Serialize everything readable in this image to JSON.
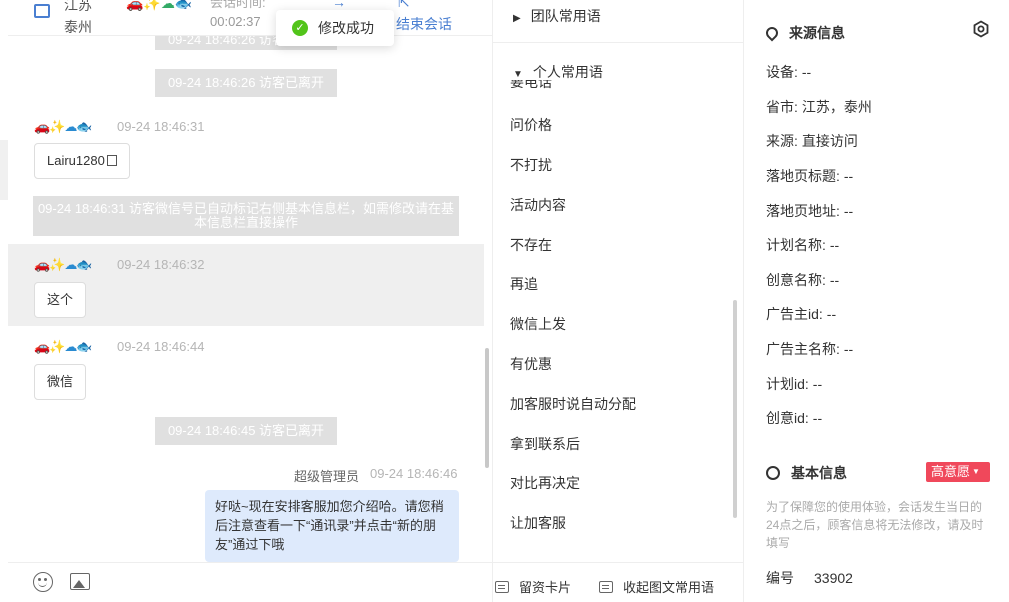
{
  "header": {
    "location": "江苏泰州",
    "duration_label": "会话时间:",
    "duration": "00:02:37",
    "end_label": "结束会话"
  },
  "toast": {
    "text": "修改成功"
  },
  "chat": {
    "clipped_top_system": "09-24 18:46:26 访客已离开",
    "system_1": "09-24 18:46:26 访客已离开",
    "visitor_avatar": "🚗✨☁🐟",
    "msg1_time": "09-24 18:46:31",
    "msg1_text": "Lairu1280",
    "system_2": "09-24 18:46:31 访客微信号已自动标记右侧基本信息栏，如需修改请在基本信息栏直接操作",
    "msg2_time": "09-24 18:46:32",
    "msg2_text": "这个",
    "msg3_time": "09-24 18:46:44",
    "msg3_text": "微信",
    "system_3": "09-24 18:46:45 访客已离开",
    "admin_name": "超级管理员",
    "admin_time": "09-24 18:46:46",
    "admin_text": "好哒~现在安排客服加您介绍哈。请您稍后注意查看一下“通讯录”并点击“新的朋友”通过下哦"
  },
  "phrases": {
    "team_group": "团队常用语",
    "personal_group": "个人常用语",
    "clipped_item": "要电话",
    "items": [
      "问价格",
      "不打扰",
      "活动内容",
      "不存在",
      "再追",
      "微信上发",
      "有优惠",
      "加客服时说自动分配",
      "拿到联系后",
      "对比再决定",
      "让加客服"
    ],
    "footer_card": "留资卡片",
    "footer_collapse": "收起图文常用语"
  },
  "info": {
    "source_title": "来源信息",
    "fields": [
      {
        "label": "设备:",
        "value": "--"
      },
      {
        "label": "省市:",
        "value": "江苏，泰州"
      },
      {
        "label": "来源:",
        "value": "直接访问"
      },
      {
        "label": "落地页标题:",
        "value": "--"
      },
      {
        "label": "落地页地址:",
        "value": "--"
      },
      {
        "label": "计划名称:",
        "value": "--"
      },
      {
        "label": "创意名称:",
        "value": "--"
      },
      {
        "label": "广告主id:",
        "value": "--"
      },
      {
        "label": "广告主名称:",
        "value": "--"
      },
      {
        "label": "计划id:",
        "value": "--"
      },
      {
        "label": "创意id:",
        "value": "--"
      }
    ],
    "basic_title": "基本信息",
    "intent_badge": "高意愿",
    "notice": "为了保障您的使用体验，会话发生当日的24点之后，顾客信息将无法修改，请及时填写",
    "id_label": "编号",
    "id_value": "33902"
  },
  "colors": {
    "accent": "#4a7fd1",
    "badge": "#f0485b",
    "admin_bubble": "#deeafc",
    "system_bg": "#e0e0e0"
  }
}
